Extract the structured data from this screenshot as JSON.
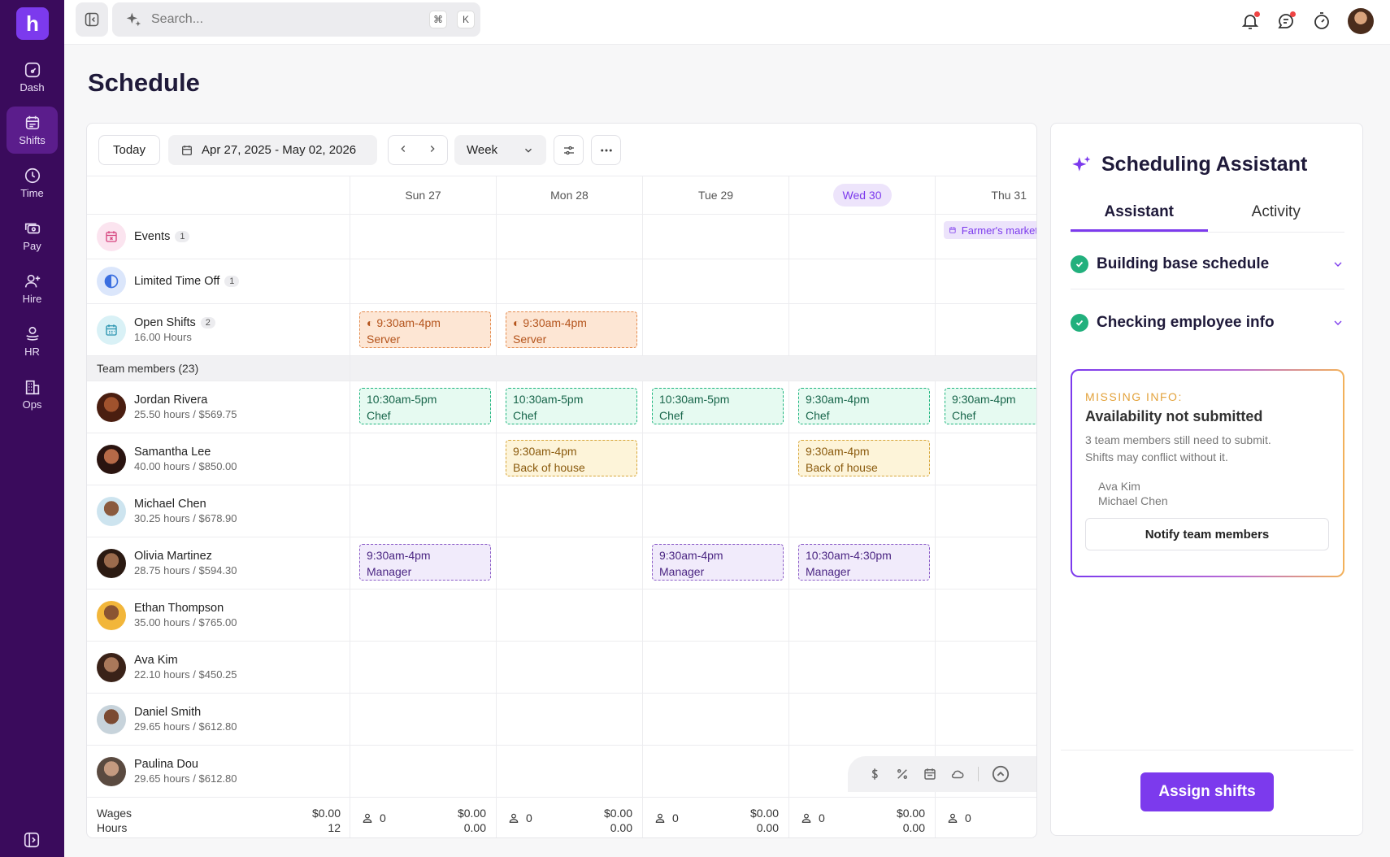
{
  "brand": {
    "logo_letter": "h"
  },
  "nav": [
    {
      "label": "Dash",
      "icon": "dashboard-icon"
    },
    {
      "label": "Shifts",
      "icon": "calendar-icon",
      "active": true
    },
    {
      "label": "Time",
      "icon": "clock-icon"
    },
    {
      "label": "Pay",
      "icon": "money-icon"
    },
    {
      "label": "Hire",
      "icon": "user-plus-icon"
    },
    {
      "label": "HR",
      "icon": "hr-icon"
    },
    {
      "label": "Ops",
      "icon": "building-icon"
    }
  ],
  "search": {
    "placeholder": "Search...",
    "shortcut_mod": "⌘",
    "shortcut_key": "K"
  },
  "page": {
    "title": "Schedule"
  },
  "toolbar": {
    "today": "Today",
    "date_range": "Apr 27, 2025 - May 02, 2026",
    "view": "Week"
  },
  "days": [
    "Sun 27",
    "Mon 28",
    "Tue 29",
    "Wed 30",
    "Thu 31"
  ],
  "rows": {
    "events": {
      "label": "Events",
      "count": "1",
      "event_text": "Farmer's market"
    },
    "time_off": {
      "label": "Limited Time Off",
      "count": "1"
    },
    "open_shifts": {
      "label": "Open Shifts",
      "count": "2",
      "hours": "16.00 Hours",
      "shifts": [
        {
          "time": "9:30am-4pm",
          "role": "Server"
        },
        {
          "time": "9:30am-4pm",
          "role": "Server"
        }
      ]
    }
  },
  "team_header": "Team members (23)",
  "members": [
    {
      "name": "Jordan Rivera",
      "stats": "25.50 hours / $569.75"
    },
    {
      "name": "Samantha Lee",
      "stats": "40.00 hours / $850.00"
    },
    {
      "name": "Michael Chen",
      "stats": "30.25 hours / $678.90"
    },
    {
      "name": "Olivia Martinez",
      "stats": "28.75 hours / $594.30"
    },
    {
      "name": "Ethan Thompson",
      "stats": "35.00 hours / $765.00"
    },
    {
      "name": "Ava Kim",
      "stats": "22.10 hours / $450.25"
    },
    {
      "name": "Daniel Smith",
      "stats": "29.65 hours / $612.80"
    },
    {
      "name": "Paulina Dou",
      "stats": "29.65 hours / $612.80"
    }
  ],
  "shifts": {
    "jordan": [
      {
        "time": "10:30am-5pm",
        "role": "Chef"
      },
      {
        "time": "10:30am-5pm",
        "role": "Chef"
      },
      {
        "time": "10:30am-5pm",
        "role": "Chef"
      },
      {
        "time": "9:30am-4pm",
        "role": "Chef"
      },
      {
        "time": "9:30am-4pm",
        "role": "Chef"
      }
    ],
    "samantha": [
      {
        "time": "9:30am-4pm",
        "role": "Back of house"
      },
      {
        "time": "9:30am-4pm",
        "role": "Back of house"
      }
    ],
    "olivia": [
      {
        "time": "9:30am-4pm",
        "role": "Manager"
      },
      {
        "time": "9:30am-4pm",
        "role": "Manager"
      },
      {
        "time": "10:30am-4:30pm",
        "role": "Manager"
      }
    ]
  },
  "footer": {
    "wages_label": "Wages",
    "hours_label": "Hours",
    "wages_total": "$0.00",
    "hours_total": "12",
    "day_staff": "0",
    "day_wages": "$0.00",
    "day_hours": "0.00"
  },
  "assistant": {
    "title": "Scheduling Assistant",
    "tabs": [
      "Assistant",
      "Activity"
    ],
    "tasks": [
      "Building base schedule",
      "Checking employee info"
    ],
    "missing": {
      "tag": "MISSING INFO:",
      "title": "Availability not submitted",
      "desc": "3 team members still need to submit. Shifts may conflict without it.",
      "names": [
        "Ava Kim",
        "Michael Chen"
      ],
      "button": "Notify team members"
    },
    "assign": "Assign shifts"
  },
  "colors": {
    "accent": "#7c3aed",
    "sidebar": "#3a0b5c",
    "success": "#22b07d"
  }
}
